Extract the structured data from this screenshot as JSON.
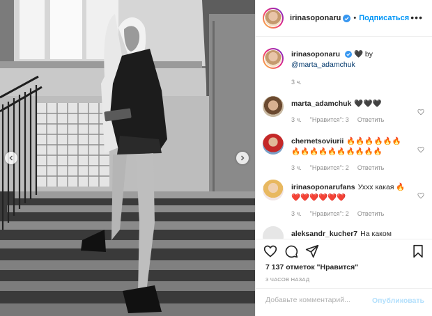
{
  "header": {
    "username": "irinasoponaru",
    "separator": "•",
    "follow_label": "Подписаться",
    "more_label": "•••"
  },
  "caption": {
    "username": "irinasoponaru",
    "text": "🖤 by",
    "mention": "@marta_adamchuk",
    "time": "3 ч."
  },
  "comments": [
    {
      "username": "marta_adamchuk",
      "text": "🖤🖤🖤",
      "time": "3 ч.",
      "likes": "\"Нравится\": 3",
      "reply": "Ответить"
    },
    {
      "username": "chernetsoviurii",
      "text": "🔥🔥🔥🔥🔥🔥🔥🔥🔥🔥🔥🔥🔥🔥🔥🔥",
      "time": "3 ч.",
      "likes": "\"Нравится\": 2",
      "reply": "Ответить"
    },
    {
      "username": "irinasoponarufans",
      "text": "Уххх какая 🔥❤️❤️❤️❤️❤️❤️",
      "time": "3 ч.",
      "likes": "\"Нравится\": 2",
      "reply": "Ответить"
    },
    {
      "username": "aleksandr_kucher7",
      "text": "На каком"
    }
  ],
  "actions": {
    "like_icon": "heart-icon",
    "comment_icon": "comment-icon",
    "share_icon": "share-icon",
    "save_icon": "bookmark-icon"
  },
  "likes_text": "7 137 отметок \"Нравится\"",
  "post_time": "3 ЧАСОВ НАЗАД",
  "add_comment": {
    "placeholder": "Добавьте комментарий...",
    "post_label": "Опубликовать"
  },
  "colors": {
    "accent": "#0095f6",
    "verified": "#3897f0",
    "muted": "#8e8e8e",
    "post_disabled": "#b2dffc"
  }
}
